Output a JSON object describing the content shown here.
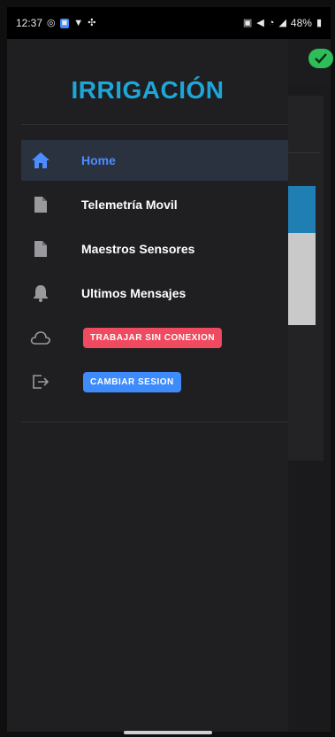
{
  "status_bar": {
    "time": "12:37",
    "battery": "48%"
  },
  "app": {
    "logo_text": "IRRIGACIÓN",
    "sync_status": "synced"
  },
  "drawer": {
    "items": [
      {
        "label": "Home",
        "icon": "home-icon",
        "active": true
      },
      {
        "label": "Telemetría Movil",
        "icon": "document-icon",
        "active": false
      },
      {
        "label": "Maestros Sensores",
        "icon": "document-icon",
        "active": false
      },
      {
        "label": "Ultimos Mensajes",
        "icon": "bell-icon",
        "active": false
      }
    ],
    "actions": [
      {
        "label": "TRABAJAR SIN CONEXION",
        "icon": "cloud-icon",
        "color": "#ef4a5f"
      },
      {
        "label": "CAMBIAR SESION",
        "icon": "logout-icon",
        "color": "#3d8bfd"
      }
    ]
  },
  "colors": {
    "accent": "#4d8cff",
    "logo": "#1ea6d9",
    "drawer_bg": "#1f1f21",
    "success": "#2ebd59"
  }
}
